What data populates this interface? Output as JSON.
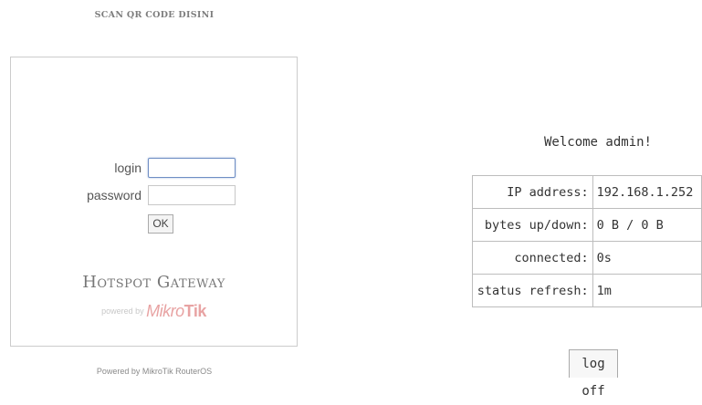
{
  "left": {
    "qr_heading": "SCAN QR CODE DISINI",
    "login_label": "login",
    "login_value": "",
    "password_label": "password",
    "password_value": "",
    "ok_label": "OK",
    "gateway_title": "Hotspot Gateway",
    "powered_by": "powered by",
    "brand_logo": "MikroTik",
    "footer": "Powered by MikroTik RouterOS"
  },
  "right": {
    "welcome": "Welcome admin!",
    "rows": [
      {
        "label": "IP address:",
        "value": "192.168.1.252"
      },
      {
        "label": "bytes up/down:",
        "value": "0 B / 0 B"
      },
      {
        "label": "connected:",
        "value": "0s"
      },
      {
        "label": "status refresh:",
        "value": "1m"
      }
    ],
    "logoff_label": "log off"
  },
  "colors": {
    "border": "#cccccc",
    "focus_border": "#6f8ec4",
    "brand": "#e8a3a3"
  }
}
